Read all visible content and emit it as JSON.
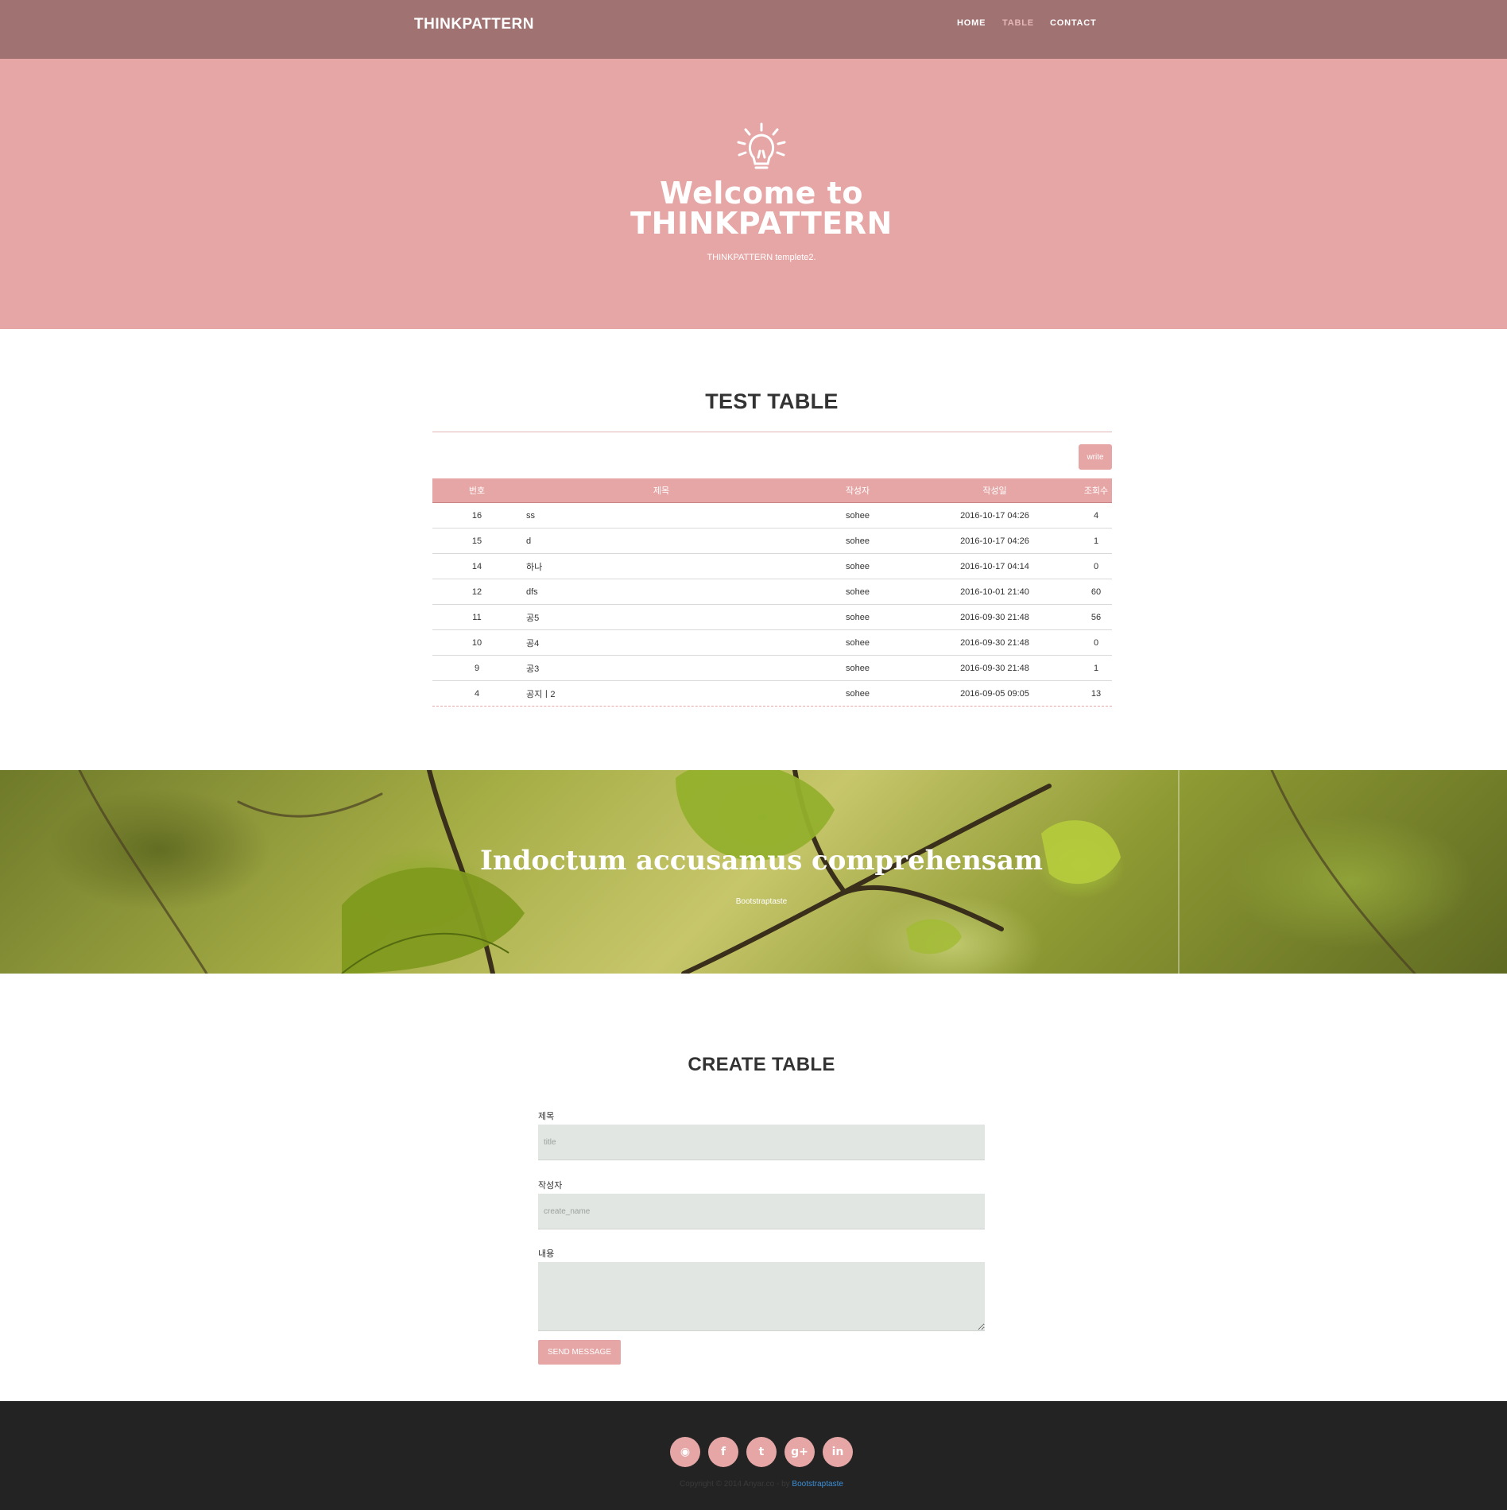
{
  "navbar": {
    "brand": "THINKPATTERN",
    "items": [
      {
        "label": "HOME"
      },
      {
        "label": "TABLE"
      },
      {
        "label": "CONTACT"
      }
    ]
  },
  "hero": {
    "icon": "lightbulb-icon",
    "title_line1": "Welcome to",
    "title_line2": "THINKPATTERN",
    "subtitle": "THINKPATTERN templete2."
  },
  "table_section": {
    "title": "TEST TABLE",
    "write_label": "write",
    "headers": [
      "번호",
      "제목",
      "작성자",
      "작성일",
      "조회수"
    ],
    "rows": [
      {
        "num": "16",
        "title": "ss",
        "author": "sohee",
        "date": "2016-10-17 04:26",
        "views": "4"
      },
      {
        "num": "15",
        "title": "d",
        "author": "sohee",
        "date": "2016-10-17 04:26",
        "views": "1"
      },
      {
        "num": "14",
        "title": "하나",
        "author": "sohee",
        "date": "2016-10-17 04:14",
        "views": "0"
      },
      {
        "num": "12",
        "title": "dfs",
        "author": "sohee",
        "date": "2016-10-01 21:40",
        "views": "60"
      },
      {
        "num": "11",
        "title": "공5",
        "author": "sohee",
        "date": "2016-09-30 21:48",
        "views": "56"
      },
      {
        "num": "10",
        "title": "공4",
        "author": "sohee",
        "date": "2016-09-30 21:48",
        "views": "0"
      },
      {
        "num": "9",
        "title": "공3",
        "author": "sohee",
        "date": "2016-09-30 21:48",
        "views": "1"
      },
      {
        "num": "4",
        "title": "공지ㅣ2",
        "author": "sohee",
        "date": "2016-09-05 09:05",
        "views": "13"
      }
    ]
  },
  "banner": {
    "title": "Indoctum accusamus comprehensam",
    "subtitle": "Bootstraptaste"
  },
  "form": {
    "title": "CREATE TABLE",
    "title_label": "제목",
    "title_placeholder": "title",
    "author_label": "작성자",
    "author_placeholder": "create_name",
    "content_label": "내용",
    "content_value": "",
    "submit_label": "SEND MESSAGE"
  },
  "footer": {
    "social": [
      {
        "icon": "rss-icon",
        "glyph": "◉"
      },
      {
        "icon": "facebook-icon",
        "glyph": "f"
      },
      {
        "icon": "twitter-icon",
        "glyph": "t"
      },
      {
        "icon": "google-plus-icon",
        "glyph": "g+"
      },
      {
        "icon": "linkedin-icon",
        "glyph": "in"
      }
    ],
    "copyright": "Copyright © 2014 Anyar.co - by",
    "link_text": "Bootstraptaste"
  },
  "colors": {
    "navbar": "#a07272",
    "accent": "#e6a6a6",
    "footer": "#232323",
    "input_bg": "#e1e6e2"
  }
}
